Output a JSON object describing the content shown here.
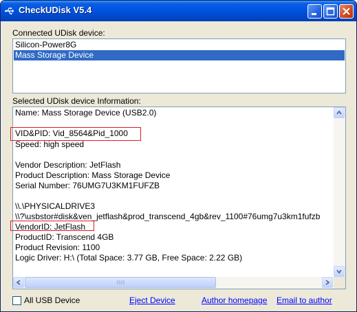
{
  "window": {
    "title": "CheckUDisk V5.4",
    "icon": "usb-icon",
    "controls": [
      "minimize-icon",
      "maximize-icon",
      "close-icon"
    ],
    "title_color": "#0055e5"
  },
  "connected": {
    "label": "Connected UDisk device:",
    "devices": [
      "Silicon-Power8G",
      "Mass Storage Device"
    ],
    "selected_index": 1
  },
  "info": {
    "label": "Selected UDisk device Information:",
    "lines": [
      "Name: Mass Storage Device  (USB2.0)",
      "",
      "VID&PID: Vid_8564&Pid_1000",
      "Speed: high speed",
      "",
      "Vendor Description: JetFlash",
      "Product Description: Mass Storage Device",
      "Serial Number: 76UMG7U3KM1FUFZB",
      "",
      "\\\\.\\PHYSICALDRIVE3",
      "\\\\?\\usbstor#disk&ven_jetflash&prod_transcend_4gb&rev_1100#76umg7u3km1fufzb",
      "VendorID: JetFlash",
      "ProductID: Transcend 4GB",
      "Product Revision: 1100",
      "Logic Driver: H:\\  (Total Space: 3.77 GB, Free Space: 2.22 GB)"
    ],
    "highlight_color": "#e0181f"
  },
  "footer": {
    "all_usb_label": "All USB Device",
    "all_usb_checked": false,
    "eject_label": "Eject Device",
    "homepage_label": "Author homepage",
    "email_label": "Email to author"
  }
}
